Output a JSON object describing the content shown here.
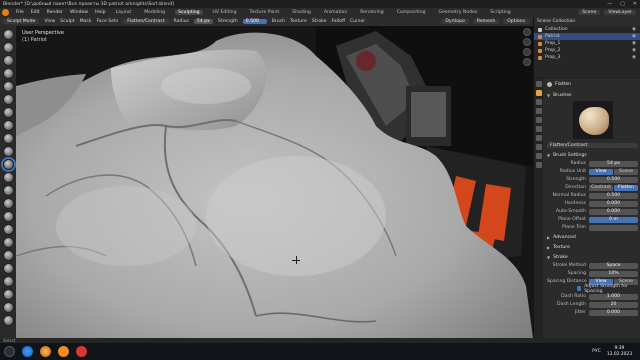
{
  "window": {
    "title": "Blender* [D:\\добный пакет\\Все проекты 3D patriot arknights\\Sort.blend]",
    "controls": [
      "—",
      "▢",
      "✕"
    ]
  },
  "menubar": {
    "menus": [
      "File",
      "Edit",
      "Render",
      "Window",
      "Help"
    ],
    "workspaces": [
      "Layout",
      "Modeling",
      "Sculpting",
      "UV Editing",
      "Texture Paint",
      "Shading",
      "Animation",
      "Rendering",
      "Compositing",
      "Geometry Nodes",
      "Scripting"
    ],
    "active_workspace_index": 2,
    "scene": "Scene",
    "view_layer": "ViewLayer"
  },
  "tool_header": {
    "mode": "Sculpt Mode",
    "view_menus": [
      "View",
      "Sculpt",
      "Mask",
      "Face Sets"
    ],
    "brush_label": "Flatten/Contrast",
    "radius_label": "Radius",
    "radius_value": "54 px",
    "strength_label": "Strength",
    "strength_value": "0.500",
    "menus": [
      "Brush",
      "Texture",
      "Stroke",
      "Falloff",
      "Cursor"
    ],
    "right_items": [
      "Dyntopo",
      "Remesh",
      "Options"
    ]
  },
  "viewport": {
    "view_name": "User Perspective",
    "object_name": "(1) Patriot"
  },
  "outliner": {
    "header": "Scene Collection",
    "rows": [
      {
        "label": "Collection",
        "selected": false,
        "icon": "collection-icon"
      },
      {
        "label": "Patriot",
        "selected": true,
        "icon": "mesh-icon"
      },
      {
        "label": "Prop_1",
        "selected": false,
        "icon": "mesh-icon"
      },
      {
        "label": "Prop_2",
        "selected": false,
        "icon": "mesh-icon"
      },
      {
        "label": "Prop_3",
        "selected": false,
        "icon": "mesh-icon"
      }
    ]
  },
  "properties": {
    "brush_name": "Flatten",
    "brushes_header": "Brushes",
    "brush_field": "Flatten/Contrast",
    "brush_settings_header": "Brush Settings",
    "fields": [
      {
        "label": "Radius",
        "value": "54 px",
        "style": "num"
      },
      {
        "label": "Radius Unit",
        "options": [
          "View",
          "Scene"
        ],
        "active": 0
      },
      {
        "label": "Strength",
        "value": "0.500",
        "style": "num"
      },
      {
        "label": "Direction",
        "options": [
          "Contrast",
          "Flatten"
        ],
        "active": 1
      },
      {
        "label": "Normal Radius",
        "value": "0.500",
        "style": "num"
      },
      {
        "label": "Hardness",
        "value": "0.000",
        "style": "num"
      },
      {
        "label": "Auto-Smooth",
        "value": "0.000",
        "style": "num"
      },
      {
        "label": "Plane Offset",
        "value": "0 m",
        "style": "blue"
      },
      {
        "label": "Plane Trim",
        "value": "",
        "style": "num"
      }
    ],
    "collapsed_sections": [
      "Advanced",
      "Texture"
    ],
    "stroke_header": "Stroke",
    "stroke_fields": [
      {
        "label": "Stroke Method",
        "value": "Space",
        "style": "num"
      },
      {
        "label": "Spacing",
        "value": "10%",
        "style": "num"
      },
      {
        "label": "Spacing Distance",
        "options": [
          "View",
          "Scene"
        ],
        "active": 0
      }
    ],
    "adjust_checkbox": "Adjust Strength for Spacing",
    "dash_fields": [
      {
        "label": "Dash Ratio",
        "value": "1.000",
        "style": "num"
      },
      {
        "label": "Dash Length",
        "value": "20",
        "style": "num"
      },
      {
        "label": "Jitter",
        "value": "0.000",
        "style": "num"
      }
    ]
  },
  "statusbar": {
    "text": "Select"
  },
  "taskbar": {
    "language": "РУС",
    "time": "9:39",
    "date": "13.02.2023"
  },
  "colors": {
    "accent_blue": "#4772b3",
    "blender_orange": "#e87d0d",
    "sculpt_gray": "#b5b5b5"
  }
}
